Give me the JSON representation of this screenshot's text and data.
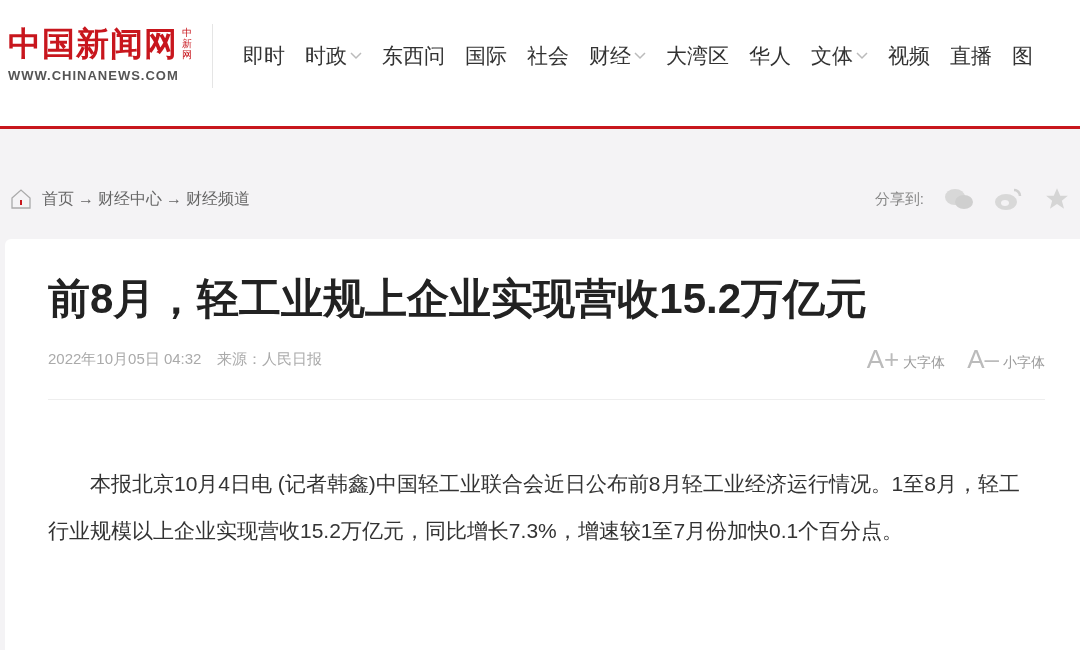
{
  "logo": {
    "name": "中国新闻网",
    "badge": "中新网",
    "url": "WWW.CHINANEWS.COM"
  },
  "nav": [
    {
      "label": "即时",
      "has_menu": false
    },
    {
      "label": "时政",
      "has_menu": true
    },
    {
      "label": "东西问",
      "has_menu": false
    },
    {
      "label": "国际",
      "has_menu": false
    },
    {
      "label": "社会",
      "has_menu": false
    },
    {
      "label": "财经",
      "has_menu": true
    },
    {
      "label": "大湾区",
      "has_menu": false
    },
    {
      "label": "华人",
      "has_menu": false
    },
    {
      "label": "文体",
      "has_menu": true
    },
    {
      "label": "视频",
      "has_menu": false
    },
    {
      "label": "直播",
      "has_menu": false
    },
    {
      "label": "图",
      "has_menu": false
    }
  ],
  "breadcrumb": [
    "首页",
    "→",
    "财经中心",
    "→",
    "财经频道"
  ],
  "share": {
    "label": "分享到:"
  },
  "article": {
    "title": "前8月，轻工业规上企业实现营收15.2万亿元",
    "date": "2022年10月05日 04:32",
    "source": "来源：人民日报",
    "font_controls": [
      {
        "sign": "A+",
        "label": "大字体"
      },
      {
        "sign": "A–",
        "label": "小字体"
      }
    ],
    "paragraphs": [
      "本报北京10月4日电 (记者韩鑫)中国轻工业联合会近日公布前8月轻工业经济运行情况。1至8月，轻工行业规模以上企业实现营收15.2万亿元，同比增长7.3%，增速较1至7月份加快0.1个百分点。"
    ]
  }
}
